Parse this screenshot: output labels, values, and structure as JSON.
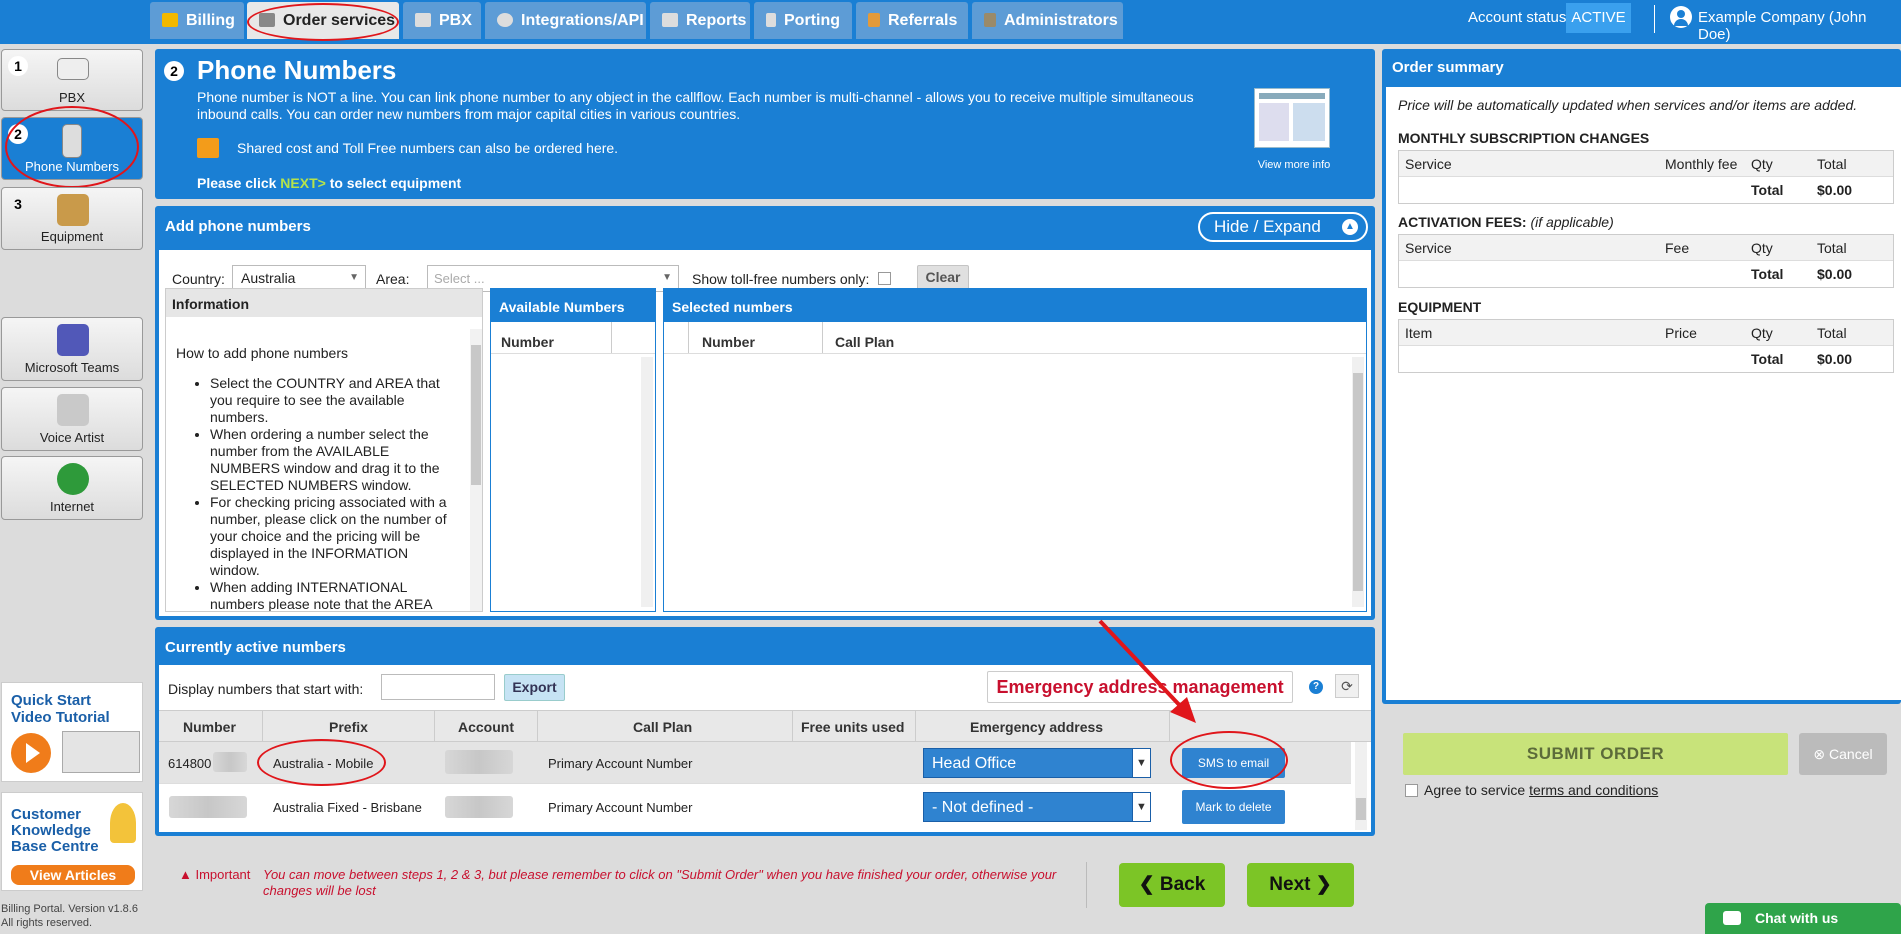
{
  "nav": {
    "tabs": [
      {
        "label": "Billing",
        "color": "#f1b800"
      },
      {
        "label": "Order services",
        "color": "#888888"
      },
      {
        "label": "PBX",
        "color": "#dddddd"
      },
      {
        "label": "Integrations/API",
        "color": "#dddddd"
      },
      {
        "label": "Reports",
        "color": "#dddddd"
      },
      {
        "label": "Porting",
        "color": "#dddddd"
      },
      {
        "label": "Referrals",
        "color": "#e39a3a"
      },
      {
        "label": "Administrators",
        "color": "#9a8a6a"
      }
    ],
    "account_status_label": "Account status:",
    "account_status": "ACTIVE",
    "user": "Example Company (John Doe)"
  },
  "sidebar": {
    "steps": [
      {
        "num": "1",
        "label": "PBX",
        "icon": "pbx-device-icon"
      },
      {
        "num": "2",
        "label": "Phone Numbers",
        "icon": "phone-icon"
      },
      {
        "num": "3",
        "label": "Equipment",
        "icon": "box-icon"
      }
    ],
    "extras": [
      {
        "label": "Microsoft Teams",
        "icon": "teams-icon"
      },
      {
        "label": "Voice Artist",
        "icon": "megaphone-icon"
      },
      {
        "label": "Internet",
        "icon": "globe-icon"
      }
    ],
    "promo_video": {
      "line1": "Quick Start",
      "line2": "Video Tutorial"
    },
    "promo_kb": {
      "line1": "Customer",
      "line2": "Knowledge",
      "line3": "Base Centre",
      "button": "View Articles"
    },
    "footer_line1": "Billing Portal. Version v1.8.6",
    "footer_line2": "All rights reserved."
  },
  "header_panel": {
    "step": "2",
    "title": "Phone Numbers",
    "desc": "Phone number is NOT a line. You can link phone number to any object in the callflow. Each number is multi-channel - allows you to receive multiple simultaneous inbound calls. You can order new numbers from major capital cities in various countries.",
    "shared_note": "Shared cost and Toll Free numbers can also be ordered here.",
    "click_pre": "Please click ",
    "click_next": "NEXT>",
    "click_post": " to select equipment",
    "view_more": "View more info"
  },
  "add_numbers": {
    "title": "Add phone numbers",
    "hide_expand": "Hide / Expand",
    "country_label": "Country:",
    "country_value": "Australia",
    "area_label": "Area:",
    "area_placeholder": "Select ...",
    "tollfree_label": "Show toll-free numbers only:",
    "clear": "Clear",
    "info_title": "Information",
    "info_intro": "How to add phone numbers",
    "info_items": [
      "Select the COUNTRY and AREA that you require to see the available numbers.",
      "When ordering a number select the number from the AVAILABLE NUMBERS window and drag it to the SELECTED NUMBERS window.",
      "For checking pricing associated with a number, please click on the number of your choice and the pricing will be displayed in the INFORMATION window.",
      "When adding INTERNATIONAL numbers please note that the AREA"
    ],
    "available_title": "Available Numbers",
    "available_col": "Number",
    "selected_title": "Selected numbers",
    "selected_col_number": "Number",
    "selected_col_plan": "Call Plan"
  },
  "active_numbers": {
    "title": "Currently active numbers",
    "filter_label": "Display numbers that start with:",
    "export": "Export",
    "emergency_mgmt": "Emergency address management",
    "columns": [
      "Number",
      "Prefix",
      "Account",
      "Call Plan",
      "Free units used",
      "Emergency address"
    ],
    "rows": [
      {
        "number": "614800",
        "prefix": "Australia - Mobile",
        "call_plan": "Primary Account Number",
        "emergency": "Head Office",
        "action": "SMS to email"
      },
      {
        "number": "",
        "prefix": "Australia Fixed - Brisbane",
        "call_plan": "Primary Account Number",
        "emergency": "- Not defined -",
        "action": "Mark to delete"
      }
    ]
  },
  "bottom": {
    "important": "Important",
    "warning": "You can move between steps 1, 2 & 3, but please remember to click on \"Submit Order\" when you have finished your order, otherwise your changes will be lost",
    "back": "Back",
    "next": "Next"
  },
  "summary": {
    "title": "Order summary",
    "note": "Price will be automatically updated when services and/or items are added.",
    "monthly_title": "MONTHLY SUBSCRIPTION CHANGES",
    "monthly_cols": [
      "Service",
      "Monthly fee",
      "Qty",
      "Total"
    ],
    "activation_title": "ACTIVATION FEES:",
    "activation_sub": "(if applicable)",
    "activation_cols": [
      "Service",
      "Fee",
      "Qty",
      "Total"
    ],
    "equipment_title": "EQUIPMENT",
    "equipment_cols": [
      "Item",
      "Price",
      "Qty",
      "Total"
    ],
    "total_label": "Total",
    "total_value": "$0.00",
    "submit": "SUBMIT ORDER",
    "cancel": "Cancel",
    "agree": "Agree to service ",
    "terms": "terms and conditions",
    "chat": "Chat with us"
  }
}
